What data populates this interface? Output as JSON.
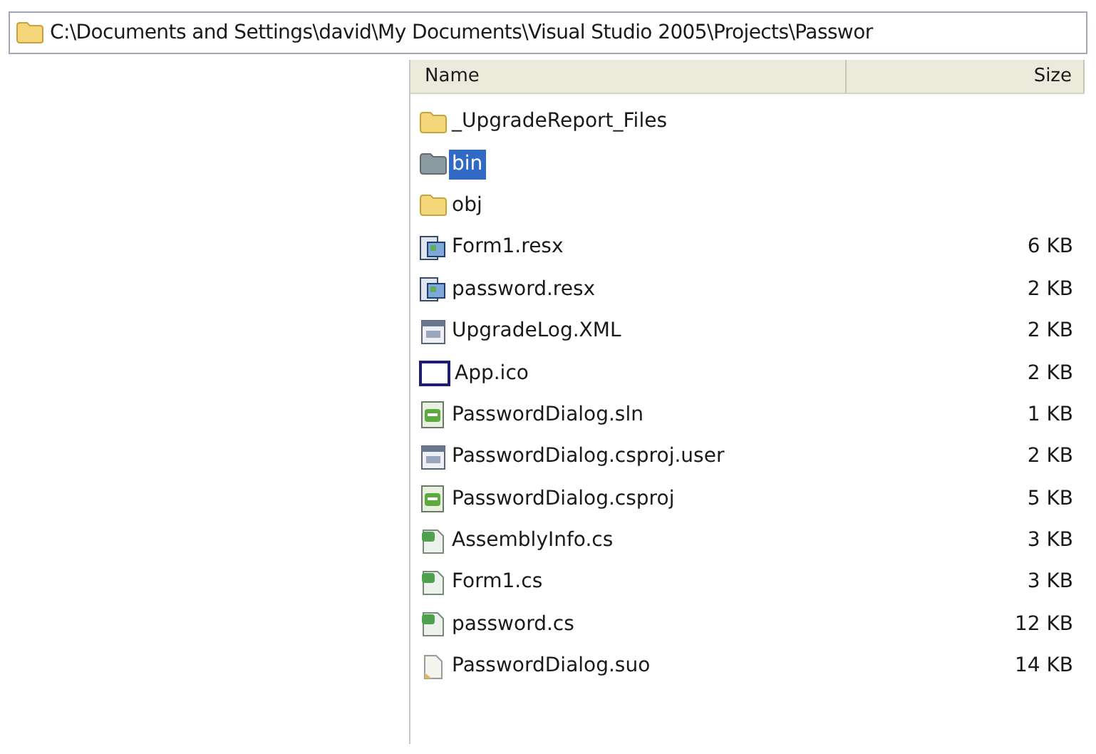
{
  "address_bar": {
    "path": "C:\\Documents and Settings\\david\\My Documents\\Visual Studio 2005\\Projects\\Passwor"
  },
  "file_list": {
    "columns": [
      "Name",
      "Size"
    ],
    "rows": [
      {
        "kind": "folder",
        "name": "_UpgradeReport_Files",
        "size": "",
        "selected": false
      },
      {
        "kind": "folder",
        "name": "bin",
        "size": "",
        "selected": true
      },
      {
        "kind": "folder",
        "name": "obj",
        "size": "",
        "selected": false
      },
      {
        "kind": "resx",
        "name": "Form1.resx",
        "size": "6 KB",
        "selected": false
      },
      {
        "kind": "resx",
        "name": "password.resx",
        "size": "2 KB",
        "selected": false
      },
      {
        "kind": "xml",
        "name": "UpgradeLog.XML",
        "size": "2 KB",
        "selected": false
      },
      {
        "kind": "ico",
        "name": "App.ico",
        "size": "2 KB",
        "selected": false
      },
      {
        "kind": "sln",
        "name": "PasswordDialog.sln",
        "size": "1 KB",
        "selected": false
      },
      {
        "kind": "xml",
        "name": "PasswordDialog.csproj.user",
        "size": "2 KB",
        "selected": false
      },
      {
        "kind": "csproj",
        "name": "PasswordDialog.csproj",
        "size": "5 KB",
        "selected": false
      },
      {
        "kind": "cs",
        "name": "AssemblyInfo.cs",
        "size": "3 KB",
        "selected": false
      },
      {
        "kind": "cs",
        "name": "Form1.cs",
        "size": "3 KB",
        "selected": false
      },
      {
        "kind": "cs",
        "name": "password.cs",
        "size": "12 KB",
        "selected": false
      },
      {
        "kind": "suo",
        "name": "PasswordDialog.suo",
        "size": "14 KB",
        "selected": false
      }
    ]
  }
}
